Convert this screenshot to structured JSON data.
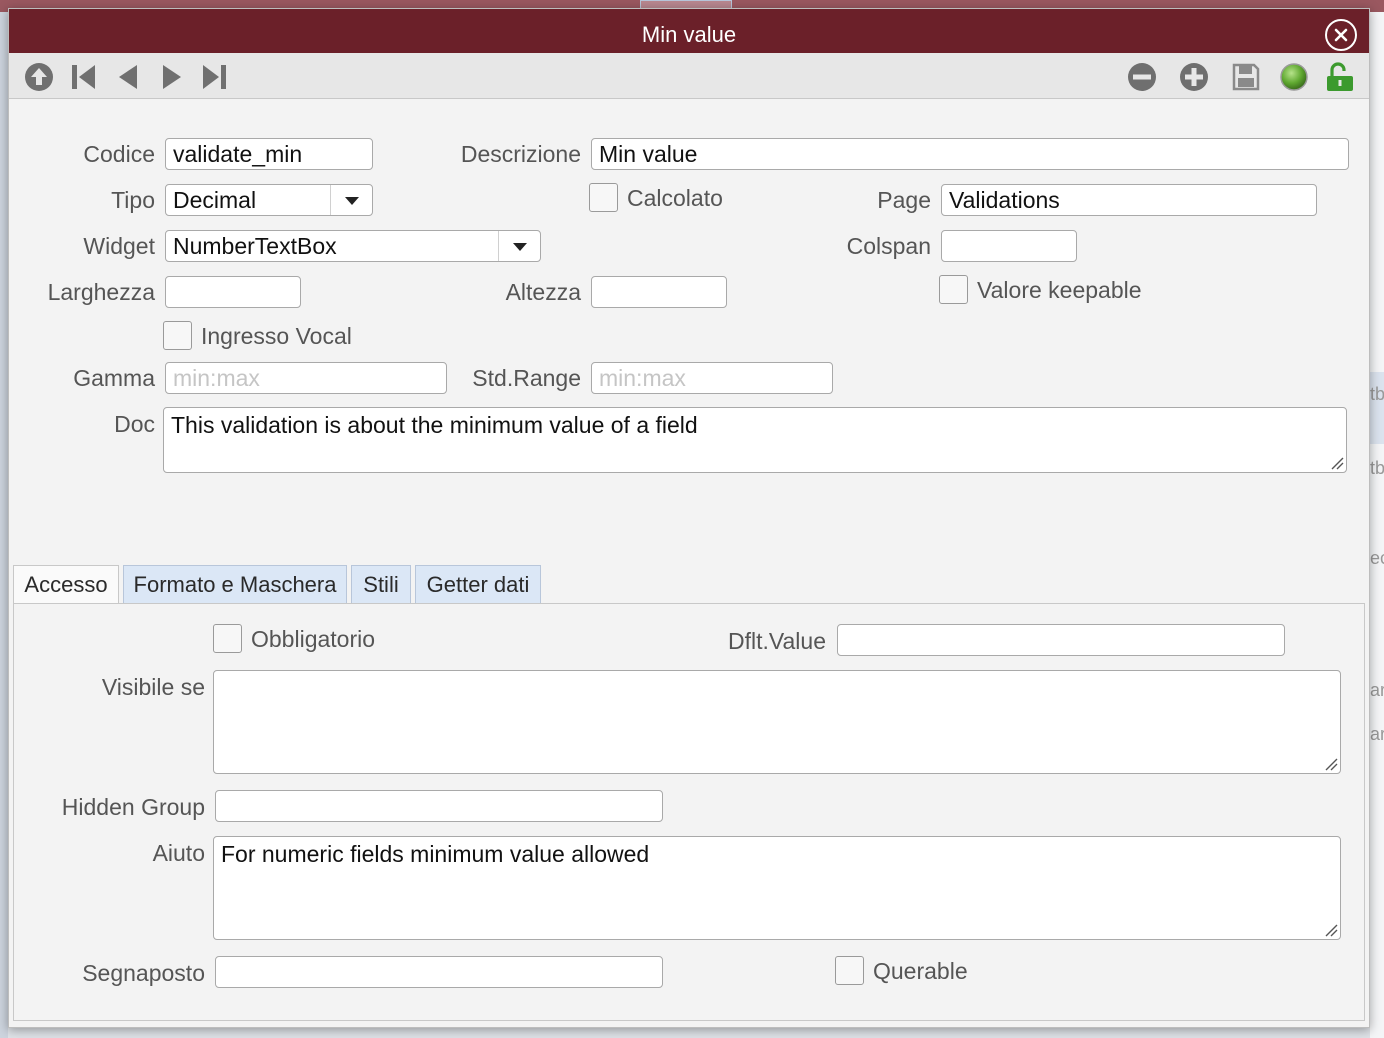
{
  "dialog": {
    "title": "Min value"
  },
  "form": {
    "codice": {
      "label": "Codice",
      "value": "validate_min"
    },
    "descrizione": {
      "label": "Descrizione",
      "value": "Min value"
    },
    "tipo": {
      "label": "Tipo",
      "value": "Decimal"
    },
    "calcolato": {
      "label": "Calcolato",
      "checked": false
    },
    "page": {
      "label": "Page",
      "value": "Validations"
    },
    "widget": {
      "label": "Widget",
      "value": "NumberTextBox"
    },
    "colspan": {
      "label": "Colspan",
      "value": ""
    },
    "larghezza": {
      "label": "Larghezza",
      "value": ""
    },
    "altezza": {
      "label": "Altezza",
      "value": ""
    },
    "valore_keepable": {
      "label": "Valore keepable",
      "checked": false
    },
    "ingresso_vocal": {
      "label": "Ingresso Vocal",
      "checked": false
    },
    "gamma": {
      "label": "Gamma",
      "placeholder": "min:max"
    },
    "std_range": {
      "label": "Std.Range",
      "placeholder": "min:max"
    },
    "doc": {
      "label": "Doc",
      "value": "This validation is about the minimum value of a field"
    }
  },
  "tabs": [
    {
      "label": "Accesso",
      "active": true
    },
    {
      "label": "Formato e Maschera",
      "active": false
    },
    {
      "label": "Stili",
      "active": false
    },
    {
      "label": "Getter dati",
      "active": false
    }
  ],
  "accesso": {
    "obbligatorio": {
      "label": "Obbligatorio",
      "checked": false
    },
    "dflt_value": {
      "label": "Dflt.Value",
      "value": ""
    },
    "visibile_se": {
      "label": "Visibile se",
      "value": ""
    },
    "hidden_group": {
      "label": "Hidden Group",
      "value": ""
    },
    "aiuto": {
      "label": "Aiuto",
      "value": "For numeric fields minimum value allowed"
    },
    "segnaposto": {
      "label": "Segnaposto",
      "value": ""
    },
    "querable": {
      "label": "Querable",
      "checked": false
    }
  },
  "background": {
    "right_fragments": [
      "tb",
      "tb",
      "ec",
      "ar",
      "ar"
    ]
  },
  "colors": {
    "titlebar": "#6b2029",
    "toolbar": "#e7e7e7",
    "tab_inactive": "#dbe7f6",
    "unlock": "#3c9a2e"
  },
  "icons": [
    "up-arrow-icon",
    "first-record-icon",
    "previous-record-icon",
    "next-record-icon",
    "last-record-icon",
    "delete-record-icon",
    "add-record-icon",
    "save-icon",
    "status-indicator-icon",
    "unlock-icon",
    "close-icon"
  ]
}
